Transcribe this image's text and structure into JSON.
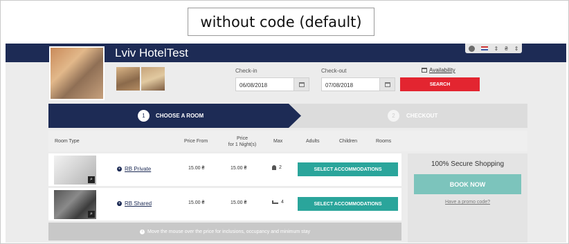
{
  "caption": "without code (default)",
  "hotel": {
    "name": "Lviv HotelTest"
  },
  "search": {
    "checkin_label": "Check-in",
    "checkin_value": "06/08/2018",
    "checkout_label": "Check-out",
    "checkout_value": "07/08/2018",
    "availability_label": "Availability",
    "search_label": "SEARCH"
  },
  "steps": [
    {
      "num": "1",
      "label": "CHOOSE A ROOM",
      "active": true
    },
    {
      "num": "2",
      "label": "CHECKOUT",
      "active": false
    }
  ],
  "table": {
    "headers": {
      "room_type": "Room Type",
      "price_from": "Price From",
      "price_line1": "Price",
      "price_line2": "for 1 Night(s)",
      "max": "Max",
      "adults": "Adults",
      "children": "Children",
      "rooms": "Rooms"
    },
    "rows": [
      {
        "name": "RB Private",
        "price_from": "15.00 ₴",
        "price_night": "15.00 ₴",
        "max": "2",
        "max_icon": "person-icon",
        "action": "SELECT ACCOMMODATIONS"
      },
      {
        "name": "RB Shared",
        "price_from": "15.00 ₴",
        "price_night": "15.00 ₴",
        "max": "4",
        "max_icon": "bed-icon",
        "action": "SELECT ACCOMMODATIONS"
      }
    ],
    "note": "Move the mouse over the price for inclusions, occupancy and minimum stay"
  },
  "sidebar": {
    "secure": "100% Secure Shopping",
    "book_now": "BOOK NOW",
    "promo": "Have a promo code?"
  },
  "colors": {
    "navy": "#1d2b55",
    "red": "#e32530",
    "teal": "#2aa59b",
    "teal_light": "#7cc4bc"
  }
}
